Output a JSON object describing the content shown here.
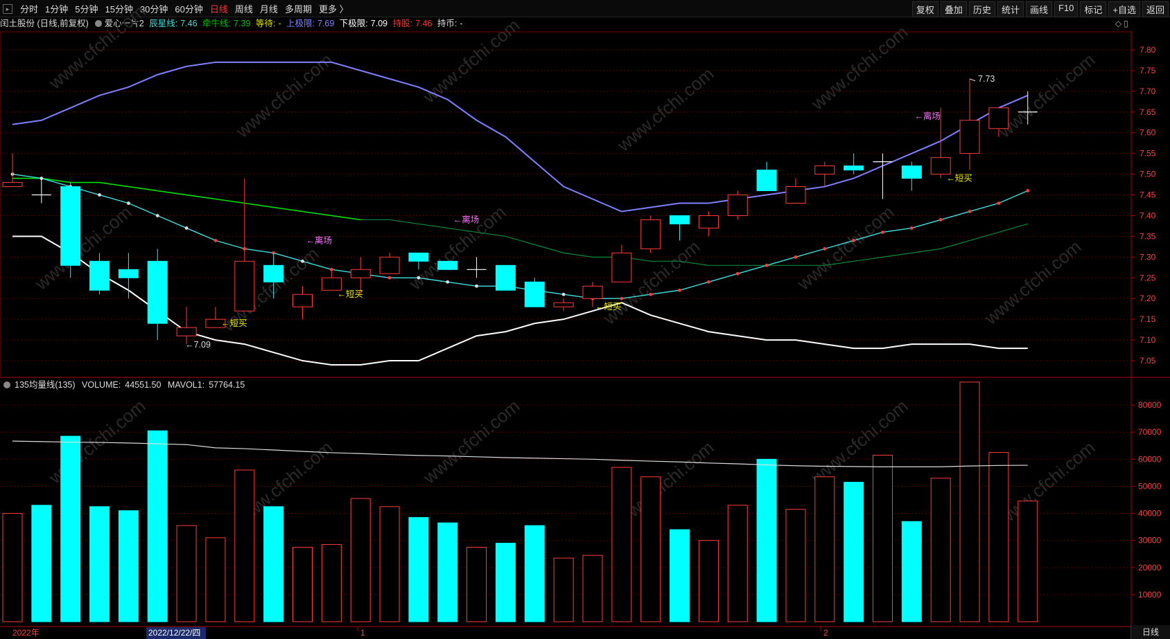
{
  "toolbar": {
    "periods": [
      "分时",
      "1分钟",
      "5分钟",
      "15分钟",
      "30分钟",
      "60分钟",
      "日线",
      "周线",
      "月线",
      "多周期",
      "更多 〉"
    ],
    "active_period": "日线",
    "buttons": [
      "复权",
      "叠加",
      "历史",
      "统计",
      "画线",
      "F10",
      "标记",
      "+自选",
      "返回"
    ]
  },
  "info": {
    "stock": "闰土股份 (日线,前复权)",
    "indicator": "爱心一片2",
    "chenxing_label": "辰星线:",
    "chenxing_value": "7.46",
    "niuniu_label": "牵牛线:",
    "niuniu_value": "7.39",
    "wait_label": "等待:",
    "wait_value": "-",
    "upper_label": "上极限:",
    "upper_value": "7.69",
    "lower_label": "下极限:",
    "lower_value": "7.09",
    "hold_label": "持股:",
    "hold_value": "7.46",
    "coin_label": "持币:",
    "coin_value": "-"
  },
  "volume_info": {
    "title": "135均量线(135)",
    "volume_label": "VOLUME:",
    "volume_value": "44551.50",
    "mavol_label": "MAVOL1:",
    "mavol_value": "57764.15"
  },
  "annotations": {
    "low": "←7.09",
    "high": "7.73",
    "short_buy": "←短买",
    "exit": "←离场"
  },
  "date_labels": [
    "2022年",
    "2022/12/22/四",
    "1",
    "2"
  ],
  "bottom_tab": "日线",
  "watermark": "www.cfchi.com",
  "colors": {
    "up": "#ff3c3c",
    "down": "#00ffff",
    "upper": "#8080ff",
    "lower": "#ffffff",
    "green": "#00e000",
    "cyan": "#40e0e0"
  },
  "chart_data": [
    {
      "type": "candlestick",
      "y_ticks": [
        "7.80",
        "7.75",
        "7.70",
        "7.65",
        "7.60",
        "7.55",
        "7.50",
        "7.45",
        "7.40",
        "7.35",
        "7.30",
        "7.25",
        "7.20",
        "7.15",
        "7.10",
        "7.05"
      ],
      "ylim": [
        7.01,
        7.84
      ],
      "candles": [
        {
          "o": 7.47,
          "c": 7.48,
          "h": 7.55,
          "l": 7.47
        },
        {
          "o": 7.45,
          "c": 7.45,
          "h": 7.49,
          "l": 7.43
        },
        {
          "o": 7.47,
          "c": 7.28,
          "h": 7.48,
          "l": 7.25
        },
        {
          "o": 7.29,
          "c": 7.22,
          "h": 7.31,
          "l": 7.21
        },
        {
          "o": 7.27,
          "c": 7.25,
          "h": 7.31,
          "l": 7.2
        },
        {
          "o": 7.29,
          "c": 7.14,
          "h": 7.32,
          "l": 7.1
        },
        {
          "o": 7.11,
          "c": 7.13,
          "h": 7.18,
          "l": 7.09
        },
        {
          "o": 7.13,
          "c": 7.15,
          "h": 7.18,
          "l": 7.13
        },
        {
          "o": 7.17,
          "c": 7.29,
          "h": 7.49,
          "l": 7.17
        },
        {
          "o": 7.28,
          "c": 7.24,
          "h": 7.31,
          "l": 7.2
        },
        {
          "o": 7.18,
          "c": 7.21,
          "h": 7.23,
          "l": 7.15
        },
        {
          "o": 7.22,
          "c": 7.25,
          "h": 7.27,
          "l": 7.22
        },
        {
          "o": 7.25,
          "c": 7.27,
          "h": 7.3,
          "l": 7.21
        },
        {
          "o": 7.26,
          "c": 7.3,
          "h": 7.31,
          "l": 7.26
        },
        {
          "o": 7.31,
          "c": 7.29,
          "h": 7.31,
          "l": 7.27
        },
        {
          "o": 7.29,
          "c": 7.27,
          "h": 7.29,
          "l": 7.27
        },
        {
          "o": 7.27,
          "c": 7.27,
          "h": 7.3,
          "l": 7.25
        },
        {
          "o": 7.28,
          "c": 7.22,
          "h": 7.28,
          "l": 7.22
        },
        {
          "o": 7.24,
          "c": 7.18,
          "h": 7.25,
          "l": 7.18
        },
        {
          "o": 7.18,
          "c": 7.19,
          "h": 7.2,
          "l": 7.17
        },
        {
          "o": 7.2,
          "c": 7.23,
          "h": 7.24,
          "l": 7.18
        },
        {
          "o": 7.24,
          "c": 7.31,
          "h": 7.33,
          "l": 7.24
        },
        {
          "o": 7.32,
          "c": 7.39,
          "h": 7.4,
          "l": 7.31
        },
        {
          "o": 7.4,
          "c": 7.38,
          "h": 7.4,
          "l": 7.34
        },
        {
          "o": 7.37,
          "c": 7.4,
          "h": 7.41,
          "l": 7.35
        },
        {
          "o": 7.4,
          "c": 7.45,
          "h": 7.46,
          "l": 7.39
        },
        {
          "o": 7.51,
          "c": 7.46,
          "h": 7.53,
          "l": 7.46
        },
        {
          "o": 7.43,
          "c": 7.47,
          "h": 7.49,
          "l": 7.43
        },
        {
          "o": 7.5,
          "c": 7.52,
          "h": 7.53,
          "l": 7.47
        },
        {
          "o": 7.52,
          "c": 7.51,
          "h": 7.55,
          "l": 7.5
        },
        {
          "o": 7.53,
          "c": 7.53,
          "h": 7.55,
          "l": 7.44
        },
        {
          "o": 7.52,
          "c": 7.49,
          "h": 7.53,
          "l": 7.46
        },
        {
          "o": 7.5,
          "c": 7.54,
          "h": 7.66,
          "l": 7.49
        },
        {
          "o": 7.55,
          "c": 7.63,
          "h": 7.73,
          "l": 7.51
        },
        {
          "o": 7.61,
          "c": 7.66,
          "h": 7.66,
          "l": 7.59
        },
        {
          "o": 7.65,
          "c": 7.65,
          "h": 7.7,
          "l": 7.62
        }
      ],
      "series": [
        {
          "name": "上极限",
          "values": [
            7.62,
            7.63,
            7.66,
            7.69,
            7.71,
            7.74,
            7.76,
            7.77,
            7.77,
            7.77,
            7.77,
            7.77,
            7.75,
            7.73,
            7.71,
            7.68,
            7.63,
            7.59,
            7.53,
            7.47,
            7.44,
            7.41,
            7.42,
            7.43,
            7.43,
            7.44,
            7.45,
            7.46,
            7.47,
            7.49,
            7.52,
            7.55,
            7.58,
            7.62,
            7.66,
            7.69
          ]
        },
        {
          "name": "下极限",
          "values": [
            7.35,
            7.35,
            7.31,
            7.26,
            7.22,
            7.17,
            7.12,
            7.1,
            7.09,
            7.07,
            7.05,
            7.04,
            7.04,
            7.05,
            7.05,
            7.08,
            7.11,
            7.12,
            7.14,
            7.15,
            7.17,
            7.19,
            7.16,
            7.14,
            7.12,
            7.11,
            7.1,
            7.1,
            7.09,
            7.08,
            7.08,
            7.09,
            7.09,
            7.09,
            7.08,
            7.08
          ]
        },
        {
          "name": "辰星线",
          "values": [
            7.5,
            7.49,
            7.47,
            7.45,
            7.43,
            7.4,
            7.37,
            7.34,
            7.32,
            7.31,
            7.29,
            7.27,
            7.26,
            7.25,
            7.25,
            7.24,
            7.23,
            7.23,
            7.22,
            7.21,
            7.2,
            7.2,
            7.21,
            7.22,
            7.24,
            7.26,
            7.28,
            7.3,
            7.32,
            7.34,
            7.36,
            7.37,
            7.39,
            7.41,
            7.43,
            7.46
          ]
        },
        {
          "name": "牵牛线",
          "values": [
            7.49,
            7.49,
            7.48,
            7.48,
            7.47,
            7.46,
            7.45,
            7.44,
            7.43,
            7.42,
            7.41,
            7.4,
            7.39,
            7.39,
            7.38,
            7.37,
            7.36,
            7.35,
            7.33,
            7.31,
            7.3,
            7.3,
            7.29,
            7.29,
            7.28,
            7.28,
            7.28,
            7.28,
            7.28,
            7.29,
            7.3,
            7.31,
            7.32,
            7.34,
            7.36,
            7.38
          ]
        }
      ]
    },
    {
      "type": "bar",
      "name": "VOLUME",
      "y_ticks": [
        "80000",
        "70000",
        "60000",
        "50000",
        "40000",
        "30000",
        "20000",
        "10000"
      ],
      "ylim": [
        0,
        90000
      ],
      "values": [
        40000,
        43000,
        68500,
        42500,
        41000,
        70500,
        35500,
        31000,
        56000,
        42500,
        27500,
        28500,
        45500,
        42500,
        38500,
        36500,
        27500,
        29000,
        35500,
        23500,
        24500,
        57000,
        53500,
        34000,
        30000,
        43000,
        60000,
        41500,
        53500,
        51500,
        61500,
        37000,
        53000,
        88500,
        62500,
        44551.5
      ],
      "ma": [
        66700,
        66500,
        66300,
        66200,
        66000,
        65700,
        65400,
        64200,
        63900,
        63400,
        62900,
        62400,
        62100,
        61700,
        61400,
        61200,
        60900,
        60600,
        60400,
        60200,
        60000,
        59600,
        59300,
        59000,
        58600,
        58300,
        57900,
        57600,
        57400,
        57300,
        57200,
        57200,
        57200,
        57500,
        57700,
        57764.15
      ]
    }
  ]
}
